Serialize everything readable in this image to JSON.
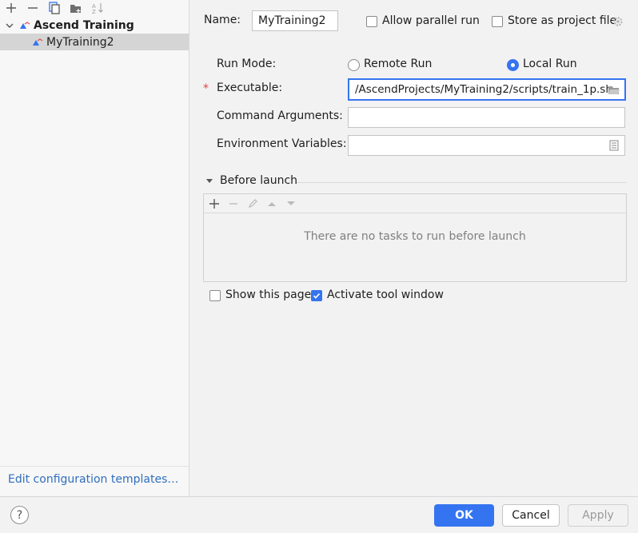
{
  "tree": {
    "group_label": "Ascend Training",
    "child_label": "MyTraining2"
  },
  "left_footer": {
    "edit_templates": "Edit configuration templates…"
  },
  "form": {
    "name_label": "Name:",
    "name_value": "MyTraining2",
    "allow_parallel_label": "Allow parallel run",
    "allow_parallel_checked": false,
    "store_project_label": "Store as project file",
    "store_project_checked": false,
    "run_mode_label": "Run Mode:",
    "run_mode_options": [
      "Remote Run",
      "Local Run"
    ],
    "run_mode_selected": "Local Run",
    "required_mark": "*",
    "executable_label": "Executable:",
    "executable_value": "/AscendProjects/MyTraining2/scripts/train_1p.sh",
    "command_args_label": "Command Arguments:",
    "command_args_value": "",
    "env_vars_label": "Environment Variables:",
    "env_vars_value": ""
  },
  "before_launch": {
    "title": "Before launch",
    "empty_text": "There are no tasks to run before launch"
  },
  "options": {
    "show_page_label": "Show this page",
    "show_page_checked": false,
    "activate_tool_label": "Activate tool window",
    "activate_tool_checked": true
  },
  "buttons": {
    "ok": "OK",
    "cancel": "Cancel",
    "apply": "Apply",
    "help": "?"
  },
  "colors": {
    "accent": "#3574f0",
    "link": "#2f6fbd",
    "required": "#dd4444"
  }
}
